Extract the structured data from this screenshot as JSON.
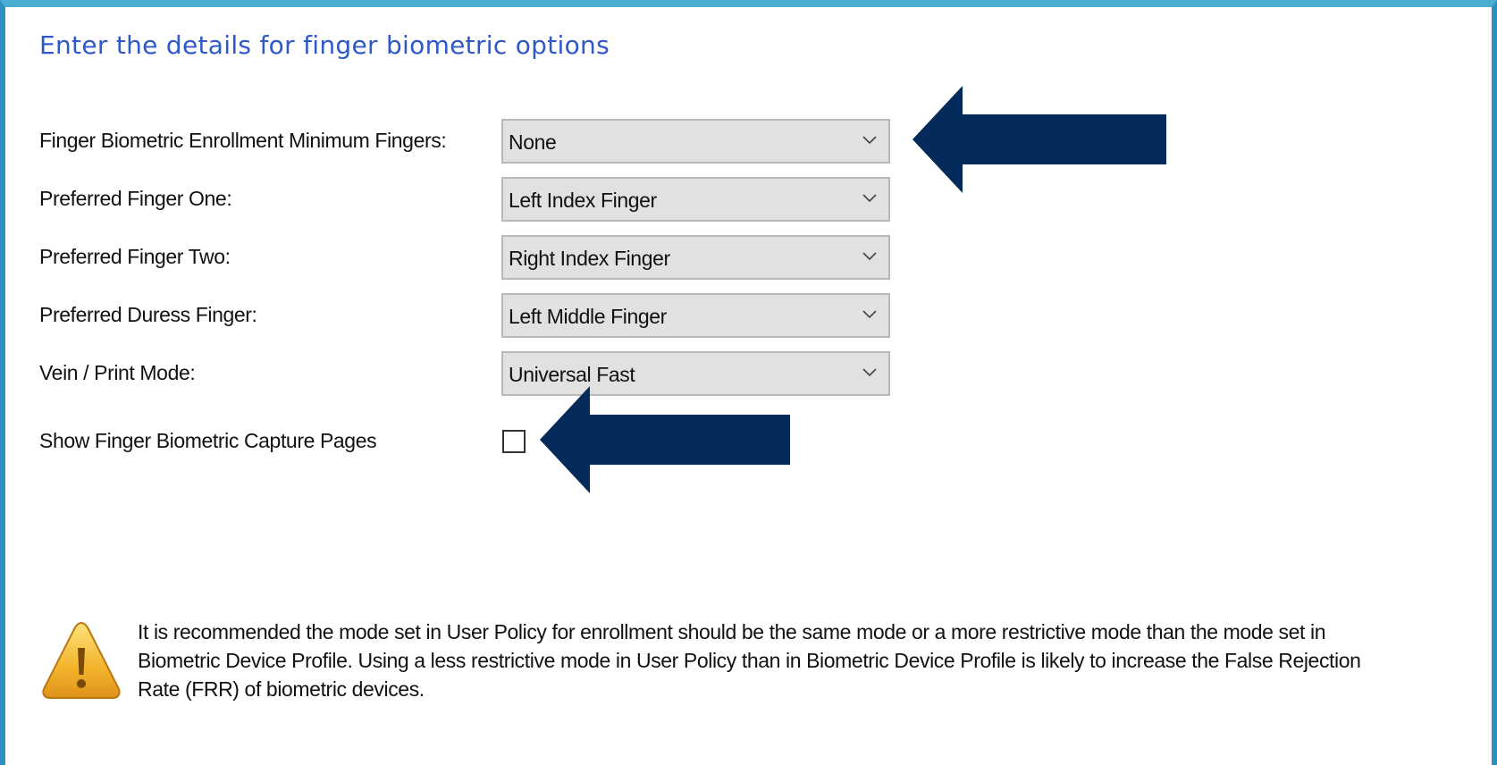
{
  "heading": "Enter the details for finger biometric options",
  "fields": [
    {
      "label": "Finger Biometric Enrollment Minimum Fingers:",
      "value": "None"
    },
    {
      "label": "Preferred Finger One:",
      "value": "Left Index Finger"
    },
    {
      "label": "Preferred Finger Two:",
      "value": "Right Index Finger"
    },
    {
      "label": "Preferred Duress Finger:",
      "value": "Left Middle Finger"
    },
    {
      "label": "Vein / Print Mode:",
      "value": "Universal Fast"
    }
  ],
  "checkbox": {
    "label": "Show Finger Biometric Capture Pages",
    "checked": false
  },
  "warning": {
    "icon": "warning-triangle-icon",
    "text": "It is recommended the mode set in User Policy for enrollment should be the same mode or a more restrictive mode than the mode set in Biometric Device Profile.  Using a less restrictive mode in User Policy than in Biometric Device Profile is likely to increase the False Rejection Rate (FRR) of biometric devices."
  },
  "colors": {
    "heading": "#2f58c8",
    "arrow": "#052b5a",
    "frame": "#4aaed0",
    "select_bg": "#e1e1e1"
  }
}
